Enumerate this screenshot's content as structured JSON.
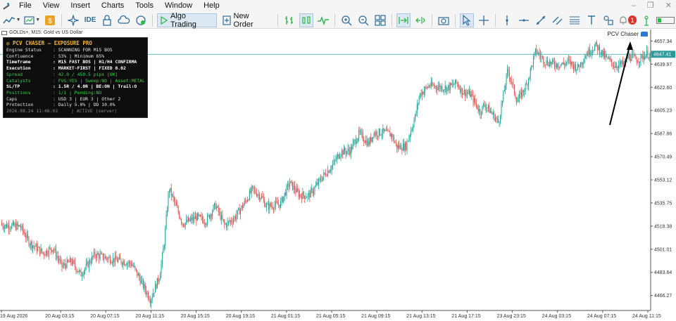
{
  "menu": {
    "items": [
      "File",
      "View",
      "Insert",
      "Charts",
      "Tools",
      "Window",
      "Help"
    ]
  },
  "toolbar": {
    "ide_label": "IDE",
    "algo_trading_label": "Algo Trading",
    "new_order_label": "New Order",
    "notification_count": "1"
  },
  "chart": {
    "title": "GOLDs+, M15:  Gold vs US Dollar",
    "ea_name": "PCV Chaser",
    "current_price_label": "4647.41",
    "colors": {
      "bull": "#1aa69a",
      "bear": "#e0514f",
      "current_line": "#35a7a7",
      "current_label_bg": "#2a9a9a",
      "arrow": "#000000"
    }
  },
  "panel": {
    "title": "PCV CHASER — EXPOSURE PRO",
    "rows": [
      {
        "key": "Engine Status",
        "value": ": SCANNING FOR M15 BOS",
        "style": "normal"
      },
      {
        "key": "Confluence",
        "value": ": 53%  |  Minimum 65%",
        "style": "normal"
      },
      {
        "key": "Timeframe",
        "value": ": M15 FAST BOS  |  H1/H4 CONFIRMA",
        "style": "bold"
      },
      {
        "key": "Execution",
        "value": ": MARKET-FIRST  |  FIXED 0.02",
        "style": "bold"
      },
      {
        "key": "Spread",
        "value": ": 42.0 / 459.5 pips [OK]",
        "style": "green"
      },
      {
        "key": "Catalysts",
        "value": ": FVG:YES  |  Sweep:NO  |  Asset:METAL",
        "style": "green"
      },
      {
        "key": "SL/TP",
        "value": ": 1.5R / 4.0R  |  BE:ON  |  Trail:O",
        "style": "bold"
      },
      {
        "key": "Positions",
        "value": ": 1/1  |  Pending:NO",
        "style": "green"
      },
      {
        "key": "Caps",
        "value": ": USD 3  |  EUR 3  |  Other 2",
        "style": "normal"
      },
      {
        "key": "Protection",
        "value": ": Daily 5.0%  |  DD 10.0%",
        "style": "normal"
      },
      {
        "key": "2026.08.24 11:48:03",
        "value": "|  ACTIVE (server)",
        "style": "dim"
      }
    ]
  },
  "chart_data": {
    "type": "candlestick",
    "symbol": "GOLDs+",
    "timeframe": "M15",
    "y_ticks": [
      4657.34,
      4639.97,
      4622.6,
      4605.23,
      4587.86,
      4570.49,
      4553.12,
      4535.75,
      4518.38,
      4501.01,
      4483.64,
      4466.27
    ],
    "ylim": [
      4455.0,
      4666.0
    ],
    "x_ticks": [
      "19 Aug 2026",
      "20 Aug 03:15",
      "20 Aug 07:15",
      "20 Aug 11:15",
      "20 Aug 15:15",
      "20 Aug 19:15",
      "21 Aug 01:15",
      "21 Aug 05:15",
      "21 Aug 09:15",
      "21 Aug 13:15",
      "21 Aug 17:15",
      "23 Aug 23:15",
      "24 Aug 03:15",
      "24 Aug 07:15",
      "24 Aug 11:15"
    ],
    "current_price": 4647.41,
    "close_path": [
      [
        0,
        4519
      ],
      [
        4,
        4518
      ],
      [
        6,
        4506
      ],
      [
        9,
        4498
      ],
      [
        11,
        4502
      ],
      [
        13,
        4488
      ],
      [
        15,
        4492
      ],
      [
        17,
        4482
      ],
      [
        20,
        4497
      ],
      [
        23,
        4494
      ],
      [
        26,
        4492
      ],
      [
        28,
        4490
      ],
      [
        30,
        4477
      ],
      [
        32,
        4463
      ],
      [
        34,
        4481
      ],
      [
        35,
        4506
      ],
      [
        36,
        4547
      ],
      [
        39,
        4520
      ],
      [
        42,
        4525
      ],
      [
        44,
        4522
      ],
      [
        46,
        4534
      ],
      [
        48,
        4519
      ],
      [
        50,
        4524
      ],
      [
        52,
        4534
      ],
      [
        54,
        4546
      ],
      [
        56,
        4540
      ],
      [
        57,
        4533
      ],
      [
        60,
        4535
      ],
      [
        62,
        4551
      ],
      [
        64,
        4542
      ],
      [
        66,
        4541
      ],
      [
        67,
        4545
      ],
      [
        69,
        4555
      ],
      [
        71,
        4563
      ],
      [
        73,
        4574
      ],
      [
        75,
        4575
      ],
      [
        77,
        4588
      ],
      [
        79,
        4580
      ],
      [
        80,
        4588
      ],
      [
        82,
        4589
      ],
      [
        84,
        4587
      ],
      [
        85,
        4578
      ],
      [
        87,
        4578
      ],
      [
        89,
        4600
      ],
      [
        90,
        4617
      ],
      [
        92,
        4624
      ],
      [
        94,
        4623
      ],
      [
        96,
        4622
      ],
      [
        98,
        4626
      ],
      [
        99,
        4620
      ],
      [
        101,
        4617
      ],
      [
        103,
        4604
      ],
      [
        104,
        4610
      ],
      [
        106,
        4601
      ],
      [
        107,
        4596
      ],
      [
        109,
        4636
      ],
      [
        111,
        4612
      ],
      [
        113,
        4624
      ],
      [
        115,
        4650
      ],
      [
        117,
        4642
      ],
      [
        119,
        4640
      ],
      [
        121,
        4640
      ],
      [
        122,
        4642
      ],
      [
        124,
        4637
      ],
      [
        126,
        4648
      ],
      [
        128,
        4654
      ],
      [
        130,
        4645
      ],
      [
        132,
        4639
      ],
      [
        134,
        4640
      ],
      [
        135,
        4646
      ],
      [
        137,
        4643
      ],
      [
        139,
        4648
      ],
      [
        140,
        4646
      ]
    ]
  }
}
